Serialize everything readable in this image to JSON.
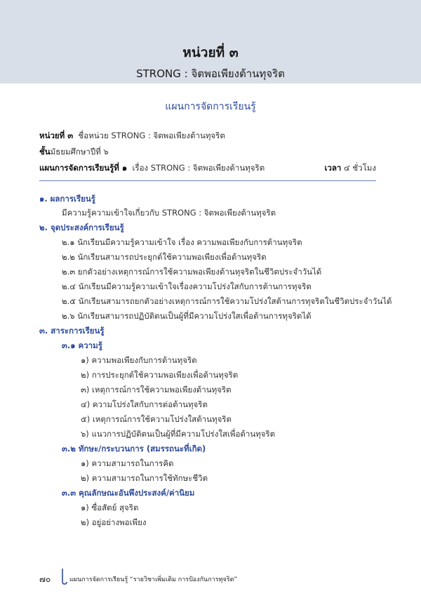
{
  "header": {
    "unit_title": "หน่วยที่ ๓",
    "unit_subtitle": "STRONG : จิตพอเพียงต้านทุจริต"
  },
  "plan_heading": "แผนการจัดการเรียนรู้",
  "meta": {
    "unit_label": "หน่วยที่ ๓",
    "unit_value": "ชื่อหน่วย STRONG : จิตพอเพียงต้านทุจริต",
    "grade_label": "ชั้น",
    "grade_value": "มัธยมศึกษาปีที่ ๖",
    "plan_label": "แผนการจัดการเรียนรู้ที่ ๑",
    "plan_value": "เรื่อง STRONG : จิตพอเพียงต้านทุจริต",
    "time_label": "เวลา",
    "time_value": "๔ ชั่วโมง"
  },
  "sections": {
    "s1_title": "๑. ผลการเรียนรู้",
    "s1_text": "มีความรู้ความเข้าใจเกี่ยวกับ STRONG : จิตพอเพียงต้านทุจริต",
    "s2_title": "๒. จุดประสงค์การเรียนรู้",
    "s2_items": [
      "๒.๑  นักเรียนมีความรู้ความเข้าใจ เรื่อง ความพอเพียงกับการต้านทุจริต",
      "๒.๒  นักเรียนสามารถประยุกต์ใช้ความพอเพียงเพื่อต้านทุจริต",
      "๒.๓  ยกตัวอย่างเหตุการณ์การใช้ความพอเพียงต้านทุจริตในชีวิตประจำวันได้",
      "๒.๔  นักเรียนมีความรู้ความเข้าใจเรื่องความโปร่งใสกับการต้านการทุจริต",
      "๒.๕  นักเรียนสามารถยกตัวอย่างเหตุการณ์การใช้ความโปร่งใสต้านการทุจริตในชีวิตประจำวันได้",
      "๒.๖  นักเรียนสามารถปฏิบัติตนเป็นผู้ที่มีความโปร่งใสเพื่อต้านการทุจริตได้"
    ],
    "s3_title": "๓. สาระการเรียนรู้",
    "s31_title": "๓.๑  ความรู้",
    "s31_items": [
      "๑) ความพอเพียงกับการต้านทุจริต",
      "๒) การประยุกต์ใช้ความพอเพียงเพื่อต้านทุจริต",
      "๓) เหตุการณ์การใช้ความพอเพียงต้านทุจริต",
      "๔) ความโปร่งใสกับการต่อต้านทุจริต",
      "๕) เหตุการณ์การใช้ความโปร่งใสต้านทุจริต",
      "๖) แนวการปฏิบัติตนเป็นผู้ที่มีความโปร่งใสเพื่อต้านทุจริต"
    ],
    "s32_title": "๓.๒  ทักษะ/กระบวนการ (สมรรถนะที่เกิด)",
    "s32_items": [
      "๑) ความสามารถในการคิด",
      "๒) ความสามารถในการใช้ทักษะชีวิต"
    ],
    "s33_title": "๓.๓  คุณลักษณะอันพึงประสงค์/ค่านิยม",
    "s33_items": [
      "๑) ซื่อสัตย์ สุจริต",
      "๒) อยู่อย่างพอเพียง"
    ]
  },
  "footer": {
    "page_number": "๗๐",
    "text": "แผนการจัดการเรียนรู้ “รายวิชาเพิ่มเติม การป้องกันการทุจริต”"
  },
  "colors": {
    "header_bg": "#d9dfe8",
    "accent_blue": "#2f4c9c"
  }
}
